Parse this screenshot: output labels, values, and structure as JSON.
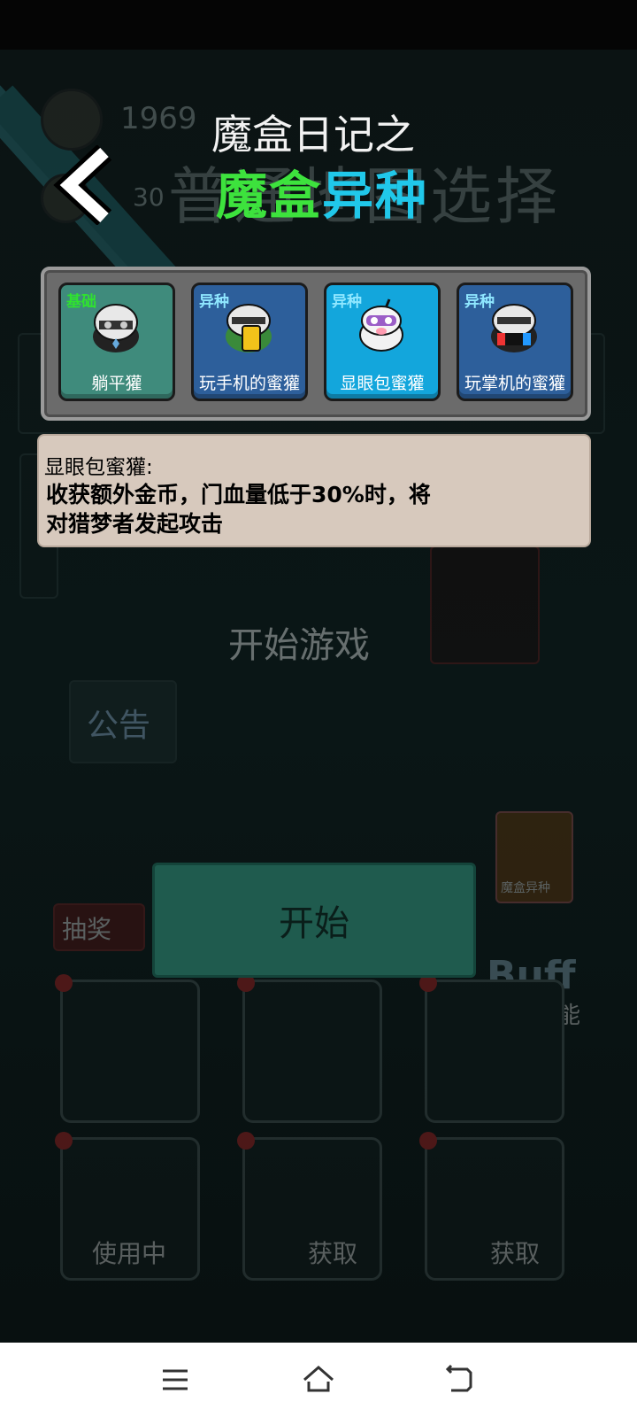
{
  "title": {
    "line1": "魔盒日记之",
    "line2_part1": "魔盒",
    "line2_part2": "异种"
  },
  "options": [
    {
      "tag": "基础",
      "name": "躺平獾",
      "selected": false
    },
    {
      "tag": "异种",
      "name": "玩手机的蜜獾",
      "selected": false
    },
    {
      "tag": "异种",
      "name": "显眼包蜜獾",
      "selected": true
    },
    {
      "tag": "异种",
      "name": "玩掌机的蜜獾",
      "selected": false
    }
  ],
  "description": {
    "heading": "显眼包蜜獾:",
    "line1": "收获额外金币，门血量低于30%时，将",
    "line2": "对猎梦者发起攻击"
  },
  "background": {
    "year": "1969",
    "number": "30",
    "big_title": "普通地图选择",
    "start_game": "开始游戏",
    "notice": "公告",
    "draw": "抽奖",
    "buff": "Buff",
    "view_skills": "查看技能",
    "in_use": "使用中",
    "obtain": "获取",
    "obtain_2": "获取",
    "magic_box_variant": "魔盒异种"
  },
  "start_button": "开始",
  "colors": {
    "green_title": "#3de23d",
    "cyan_title": "#20c8ea",
    "selected_card": "#13a6dc",
    "variant_card": "#2d5f9b",
    "base_card": "#3f8b7c",
    "desc_bg": "#d7c9bd"
  },
  "icons": {
    "back": "chevron-left-icon",
    "menu": "menu-icon",
    "home": "home-icon",
    "back_nav": "back-arrow-icon"
  }
}
